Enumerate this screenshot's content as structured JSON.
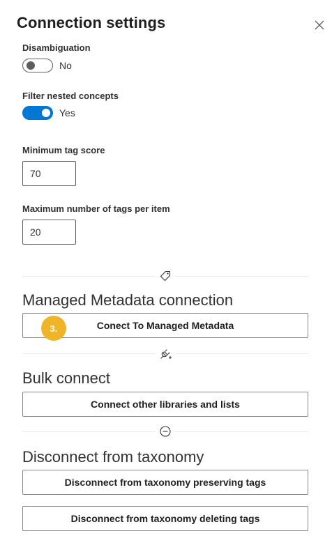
{
  "panel": {
    "title": "Connection settings"
  },
  "disambiguation": {
    "label": "Disambiguation",
    "state": "No",
    "checked": false
  },
  "filter_nested": {
    "label": "Filter nested concepts",
    "state": "Yes",
    "checked": true
  },
  "min_tag_score": {
    "label": "Minimum tag score",
    "value": "70"
  },
  "max_tags": {
    "label": "Maximum number of tags per item",
    "value": "20"
  },
  "managed_metadata": {
    "heading": "Managed Metadata connection",
    "button": "Conect To Managed Metadata",
    "step_badge": "3.",
    "icon": "tag-icon"
  },
  "bulk_connect": {
    "heading": "Bulk connect",
    "button": "Connect other libraries and lists",
    "icon": "plug-connect-icon"
  },
  "disconnect": {
    "heading": "Disconnect from taxonomy",
    "button_preserve": "Disconnect from taxonomy preserving tags",
    "button_delete": "Disconnect from taxonomy deleting tags",
    "icon": "remove-circle-icon"
  },
  "colors": {
    "accent": "#0078d4",
    "badge": "#f0b429",
    "text": "#323130"
  }
}
